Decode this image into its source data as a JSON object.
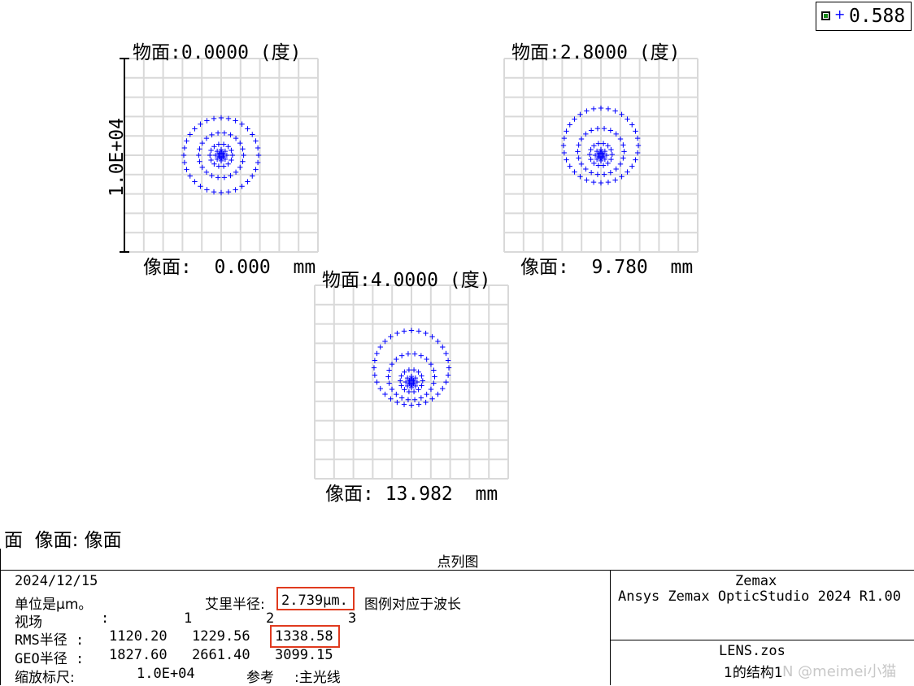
{
  "legend": {
    "wavelength": "0.588",
    "color": "#0000ff"
  },
  "scale_label": "1.0E+04",
  "surface_line": "面  像面: 像面",
  "chart_data": [
    {
      "type": "scatter",
      "title": "物面:0.0000 (度)",
      "footer": "像面:  0.000  mm",
      "ring_radii": [
        0.15,
        0.3,
        0.6,
        1.0
      ],
      "ring_points": [
        8,
        14,
        22,
        32
      ],
      "center_offset_y": 0.0,
      "ring_offsets_y": [
        0,
        0,
        0,
        0
      ]
    },
    {
      "type": "scatter",
      "title": "物面:2.8000 (度)",
      "footer": "像面:  9.780  mm",
      "ring_radii": [
        0.15,
        0.3,
        0.62,
        1.0
      ],
      "ring_points": [
        8,
        14,
        22,
        32
      ],
      "center_offset_y": 0.0,
      "ring_offsets_y": [
        0,
        -0.05,
        -0.25,
        -0.65
      ]
    },
    {
      "type": "scatter",
      "title": "物面:4.0000 (度)",
      "footer": "像面: 13.982  mm",
      "ring_radii": [
        0.15,
        0.3,
        0.62,
        1.0
      ],
      "ring_points": [
        8,
        14,
        22,
        32
      ],
      "center_offset_y": 0.0,
      "ring_offsets_y": [
        0,
        -0.08,
        -0.35,
        -0.95
      ]
    }
  ],
  "info": {
    "title": "点列图",
    "date": "2024/12/15",
    "units": "单位是µm。",
    "airy_label": "艾里半径:",
    "airy_value": "2.739µm.",
    "legend_note": "图例对应于波长",
    "field_label": "视场",
    "field_colon": ":",
    "fields": [
      "1",
      "2",
      "3"
    ],
    "rms_label": "RMS半径 :",
    "rms_values": [
      "1120.20",
      "1229.56",
      "1338.58"
    ],
    "geo_label": "GEO半径 :",
    "geo_values": [
      "1827.60",
      "2661.40",
      "3099.15"
    ],
    "scale_label": "缩放标尺:",
    "scale_value": "1.0E+04",
    "ref_label": "参考",
    "ref_value": ":主光线",
    "vendor": "Zemax",
    "product": "Ansys Zemax OpticStudio 2024 R1.00",
    "file": "LENS.zos",
    "config": "1的结构1",
    "watermark": "N @meimei小猫"
  }
}
